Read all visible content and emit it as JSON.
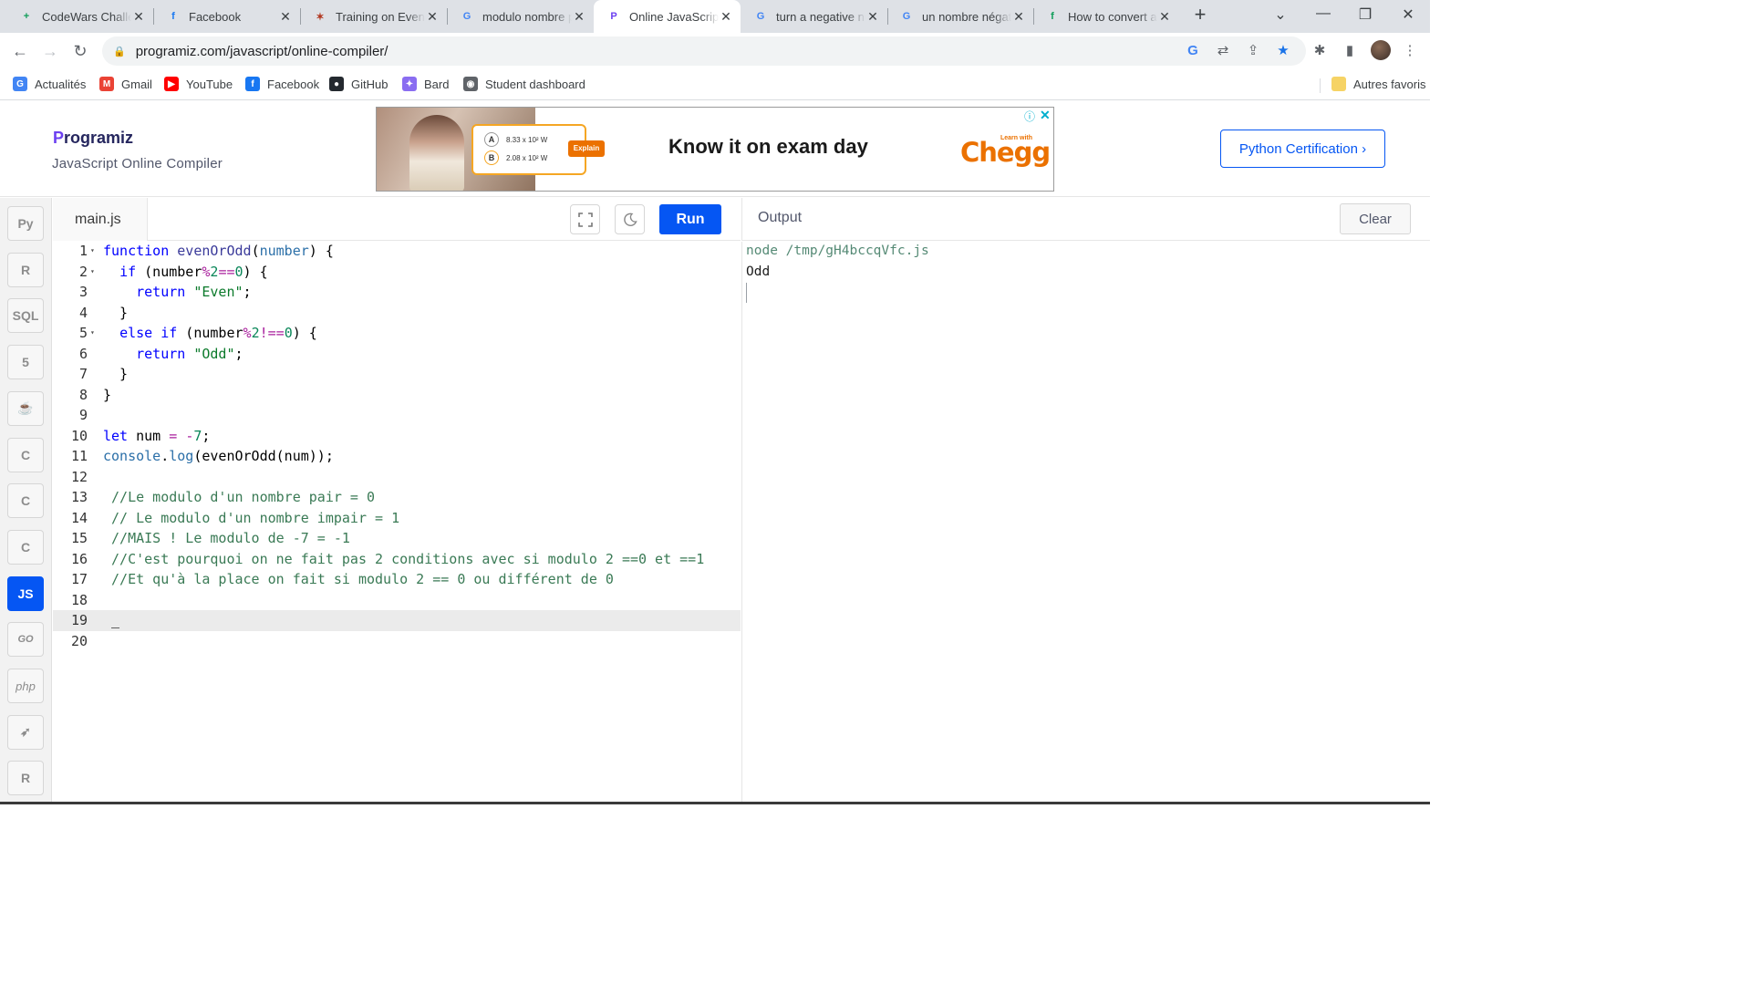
{
  "browser": {
    "tabs": [
      {
        "title": "CodeWars Challenges",
        "favicon": "sheets-icon",
        "color": "#0f9d58",
        "glyph": "+"
      },
      {
        "title": "Facebook",
        "favicon": "facebook-icon",
        "color": "#1877f2",
        "glyph": "f"
      },
      {
        "title": "Training on Even or Odd",
        "favicon": "codewars-icon",
        "color": "#b1361e",
        "glyph": "✶"
      },
      {
        "title": "modulo nombre pair",
        "favicon": "google-icon",
        "color": "#4285f4",
        "glyph": "G"
      },
      {
        "title": "Online JavaScript Compiler",
        "favicon": "programiz-icon",
        "color": "#6c40f1",
        "glyph": "P"
      },
      {
        "title": "turn a negative number",
        "favicon": "google-icon",
        "color": "#4285f4",
        "glyph": "G"
      },
      {
        "title": "un nombre négatif",
        "favicon": "google-icon",
        "color": "#4285f4",
        "glyph": "G"
      },
      {
        "title": "How to convert a",
        "favicon": "freecodecamp-icon",
        "color": "#0f9d58",
        "glyph": "f"
      }
    ],
    "active_tab": 4,
    "url": "programiz.com/javascript/online-compiler/",
    "bookmarks": [
      {
        "label": "Actualités",
        "icon": "google-news-icon",
        "color": "#4285f4",
        "glyph": "G"
      },
      {
        "label": "Gmail",
        "icon": "gmail-icon",
        "color": "#ea4335",
        "glyph": "M"
      },
      {
        "label": "YouTube",
        "icon": "youtube-icon",
        "color": "#ff0000",
        "glyph": "▶"
      },
      {
        "label": "Facebook",
        "icon": "facebook-icon",
        "color": "#1877f2",
        "glyph": "f"
      },
      {
        "label": "GitHub",
        "icon": "github-icon",
        "color": "#24292f",
        "glyph": "●"
      },
      {
        "label": "Bard",
        "icon": "bard-icon",
        "color": "#8a6df1",
        "glyph": "✦"
      },
      {
        "label": "Student dashboard",
        "icon": "globe-icon",
        "color": "#5f6368",
        "glyph": "◉"
      }
    ],
    "other_bookmarks": "Autres favoris"
  },
  "site": {
    "logo": "rogramiz",
    "logo_p": "P",
    "subtitle": "JavaScript Online Compiler",
    "cert_button": "Python Certification ›",
    "ad": {
      "headline": "Know it on exam day",
      "brand": "Chegg",
      "learn_with": "Learn with",
      "option_a": "A",
      "option_a_value": "8.33 x 10² W",
      "option_b": "B",
      "option_b_value": "2.08 x 10² W",
      "explain": "Explain"
    }
  },
  "languages": [
    {
      "name": "python-icon",
      "label": "Py"
    },
    {
      "name": "r-icon",
      "label": "R"
    },
    {
      "name": "sql-icon",
      "label": "SQL"
    },
    {
      "name": "html-icon",
      "label": "5"
    },
    {
      "name": "java-icon",
      "label": "☕"
    },
    {
      "name": "c-icon",
      "label": "C"
    },
    {
      "name": "cpp-icon",
      "label": "C"
    },
    {
      "name": "csharp-icon",
      "label": "C"
    },
    {
      "name": "javascript-icon",
      "label": "JS",
      "active": true
    },
    {
      "name": "go-icon",
      "label": "GO"
    },
    {
      "name": "php-icon",
      "label": "php"
    },
    {
      "name": "swift-icon",
      "label": "➶"
    },
    {
      "name": "rust-icon",
      "label": "R"
    }
  ],
  "editor": {
    "filename": "main.js",
    "run_label": "Run",
    "lines": [
      {
        "n": "1",
        "fold": true
      },
      {
        "n": "2",
        "fold": true
      },
      {
        "n": "3"
      },
      {
        "n": "4"
      },
      {
        "n": "5",
        "fold": true
      },
      {
        "n": "6"
      },
      {
        "n": "7"
      },
      {
        "n": "8"
      },
      {
        "n": "9"
      },
      {
        "n": "10"
      },
      {
        "n": "11"
      },
      {
        "n": "12"
      },
      {
        "n": "13"
      },
      {
        "n": "14"
      },
      {
        "n": "15"
      },
      {
        "n": "16"
      },
      {
        "n": "17"
      },
      {
        "n": "18"
      },
      {
        "n": "19"
      },
      {
        "n": "20"
      }
    ],
    "code": [
      [
        [
          "kw",
          "function"
        ],
        [
          "t",
          " "
        ],
        [
          "fn",
          "evenOrOdd"
        ],
        [
          "t",
          "("
        ],
        [
          "par",
          "number"
        ],
        [
          "t",
          ") {"
        ]
      ],
      [
        [
          "t",
          "  "
        ],
        [
          "kw",
          "if"
        ],
        [
          "t",
          " (number"
        ],
        [
          "op",
          "%"
        ],
        [
          "num",
          "2"
        ],
        [
          "op",
          "=="
        ],
        [
          "num",
          "0"
        ],
        [
          "t",
          ") {"
        ]
      ],
      [
        [
          "t",
          "    "
        ],
        [
          "kw",
          "return"
        ],
        [
          "t",
          " "
        ],
        [
          "str",
          "\"Even\""
        ],
        [
          "t",
          ";"
        ]
      ],
      [
        [
          "t",
          "  }"
        ]
      ],
      [
        [
          "t",
          "  "
        ],
        [
          "kw",
          "else"
        ],
        [
          "t",
          " "
        ],
        [
          "kw",
          "if"
        ],
        [
          "t",
          " (number"
        ],
        [
          "op",
          "%"
        ],
        [
          "num",
          "2"
        ],
        [
          "op",
          "!=="
        ],
        [
          "num",
          "0"
        ],
        [
          "t",
          ") {"
        ]
      ],
      [
        [
          "t",
          "    "
        ],
        [
          "kw",
          "return"
        ],
        [
          "t",
          " "
        ],
        [
          "str",
          "\"Odd\""
        ],
        [
          "t",
          ";"
        ]
      ],
      [
        [
          "t",
          "  }"
        ]
      ],
      [
        [
          "t",
          "}"
        ]
      ],
      [
        [
          "t",
          ""
        ]
      ],
      [
        [
          "kw",
          "let"
        ],
        [
          "t",
          " num "
        ],
        [
          "op",
          "="
        ],
        [
          "t",
          " "
        ],
        [
          "op",
          "-"
        ],
        [
          "num",
          "7"
        ],
        [
          "t",
          ";"
        ]
      ],
      [
        [
          "prop",
          "console"
        ],
        [
          "t",
          "."
        ],
        [
          "prop",
          "log"
        ],
        [
          "t",
          "(evenOrOdd(num));"
        ]
      ],
      [
        [
          "t",
          ""
        ]
      ],
      [
        [
          "cm",
          " //Le modulo d'un nombre pair = 0"
        ]
      ],
      [
        [
          "cm",
          " // Le modulo d'un nombre impair = 1"
        ]
      ],
      [
        [
          "cm",
          " //MAIS ! Le modulo de -7 = -1"
        ]
      ],
      [
        [
          "cm",
          " //C'est pourquoi on ne fait pas 2 conditions avec si modulo 2 ==0 et ==1"
        ]
      ],
      [
        [
          "cm",
          " //Et qu'à la place on fait si modulo 2 == 0 ou différent de 0"
        ]
      ],
      [
        [
          "t",
          ""
        ]
      ],
      [
        [
          "t",
          " _"
        ]
      ],
      [
        [
          "t",
          ""
        ]
      ]
    ],
    "active_line": 19
  },
  "output": {
    "title": "Output",
    "clear_label": "Clear",
    "lines": [
      "node /tmp/gH4bccqVfc.js",
      "Odd"
    ]
  }
}
